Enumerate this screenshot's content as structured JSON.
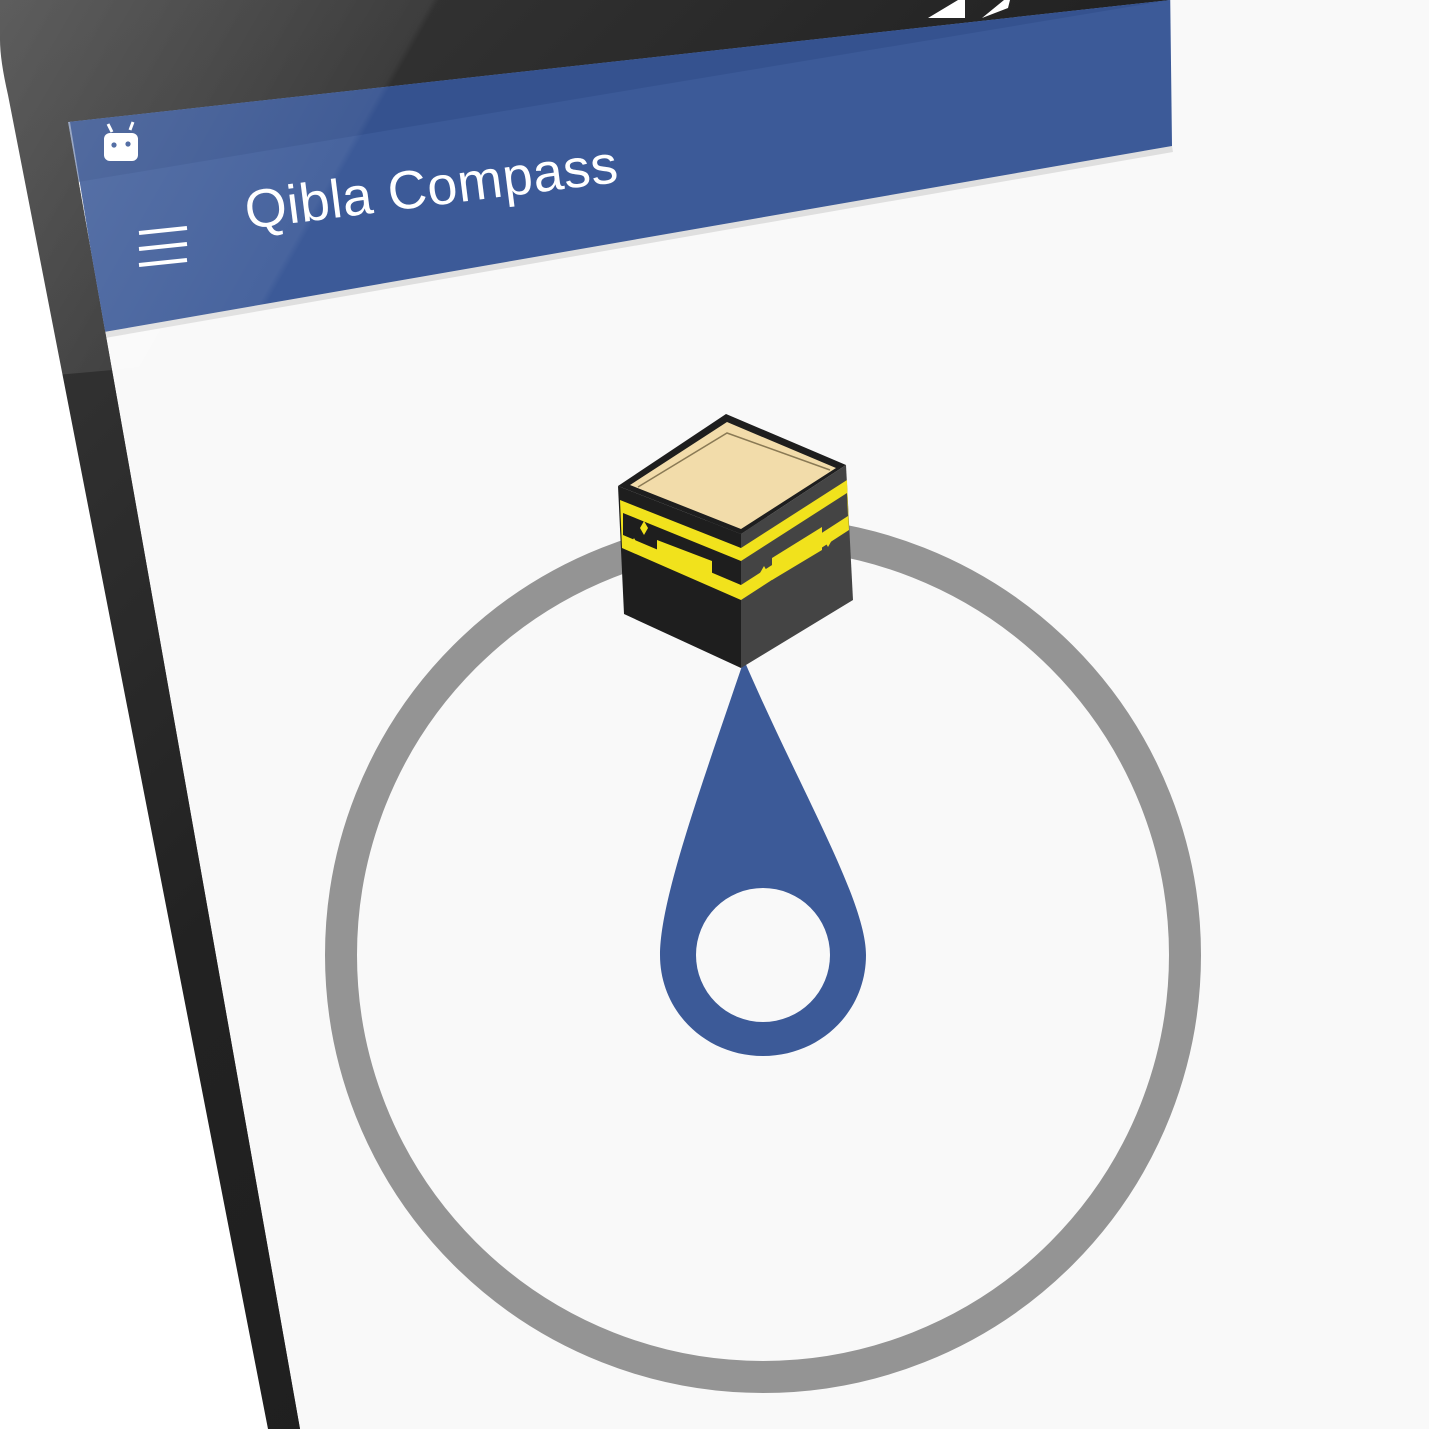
{
  "app": {
    "title": "Qibla Compass"
  },
  "status_bar": {
    "left_icon": "android-notification-icon",
    "right_icons": [
      "signal-icon"
    ]
  },
  "toolbar": {
    "menu_icon": "hamburger-menu-icon"
  },
  "compass": {
    "target_icon": "kaaba-icon",
    "pointer_icon": "location-pin-icon"
  },
  "colors": {
    "primary": "#3C5A98",
    "primary_dark": "#2A4278",
    "background": "#F9F9F9",
    "ring": "#949494",
    "phone_body": "#262626",
    "kaaba_roof": "#F2DCAA",
    "kaaba_band": "#F1E21C",
    "kaaba_dark": "#1E1E1E"
  }
}
